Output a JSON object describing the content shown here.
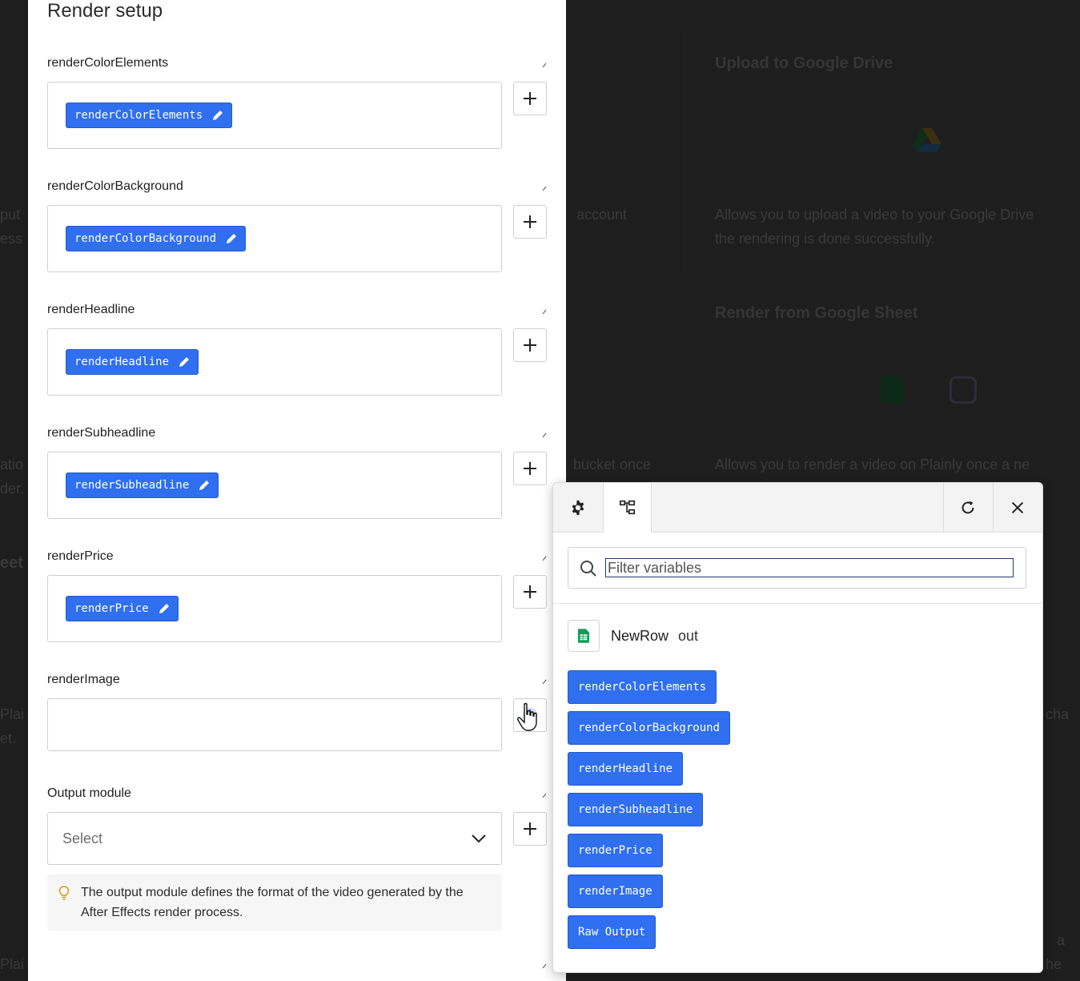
{
  "background": {
    "cards": [
      {
        "title": "Upload to Google Drive",
        "line1": "Allows you to upload a video to your Google Drive",
        "line2": "the rendering is done successfully."
      },
      {
        "title": "Render from Google Sheet",
        "line1": "Allows you to render a video on Plainly once a ne"
      }
    ],
    "middle_texts": [
      "account",
      "bucket once"
    ],
    "left_texts": [
      "put",
      "ess",
      "atio",
      "der.",
      "eet",
      "Plai",
      "et.",
      "Plai"
    ],
    "right_edge_texts": [
      "cha",
      "a",
      "he"
    ]
  },
  "panel": {
    "title": "Render setup",
    "fields": [
      {
        "label": "renderColorElements",
        "tag": "renderColorElements"
      },
      {
        "label": "renderColorBackground",
        "tag": "renderColorBackground"
      },
      {
        "label": "renderHeadline",
        "tag": "renderHeadline"
      },
      {
        "label": "renderSubheadline",
        "tag": "renderSubheadline"
      },
      {
        "label": "renderPrice",
        "tag": "renderPrice"
      },
      {
        "label": "renderImage",
        "tag": ""
      }
    ],
    "output_module": {
      "label": "Output module",
      "placeholder": "Select",
      "hint": "The output module defines the format of the video generated by the After Effects render process."
    }
  },
  "popup": {
    "tabs": [
      {
        "icon": "gear-icon"
      },
      {
        "icon": "tree-icon",
        "active": true
      }
    ],
    "actions": [
      {
        "icon": "refresh-icon"
      },
      {
        "icon": "close-icon"
      }
    ],
    "search": {
      "placeholder": "Filter variables",
      "value": ""
    },
    "source": {
      "name": "NewRow",
      "suffix": "out",
      "icon": "google-sheets-icon"
    },
    "variables": [
      "renderColorElements",
      "renderColorBackground",
      "renderHeadline",
      "renderSubheadline",
      "renderPrice",
      "renderImage",
      "Raw Output"
    ]
  },
  "colors": {
    "accent": "#2f6ff0",
    "sheets_green": "#0f9d58"
  }
}
